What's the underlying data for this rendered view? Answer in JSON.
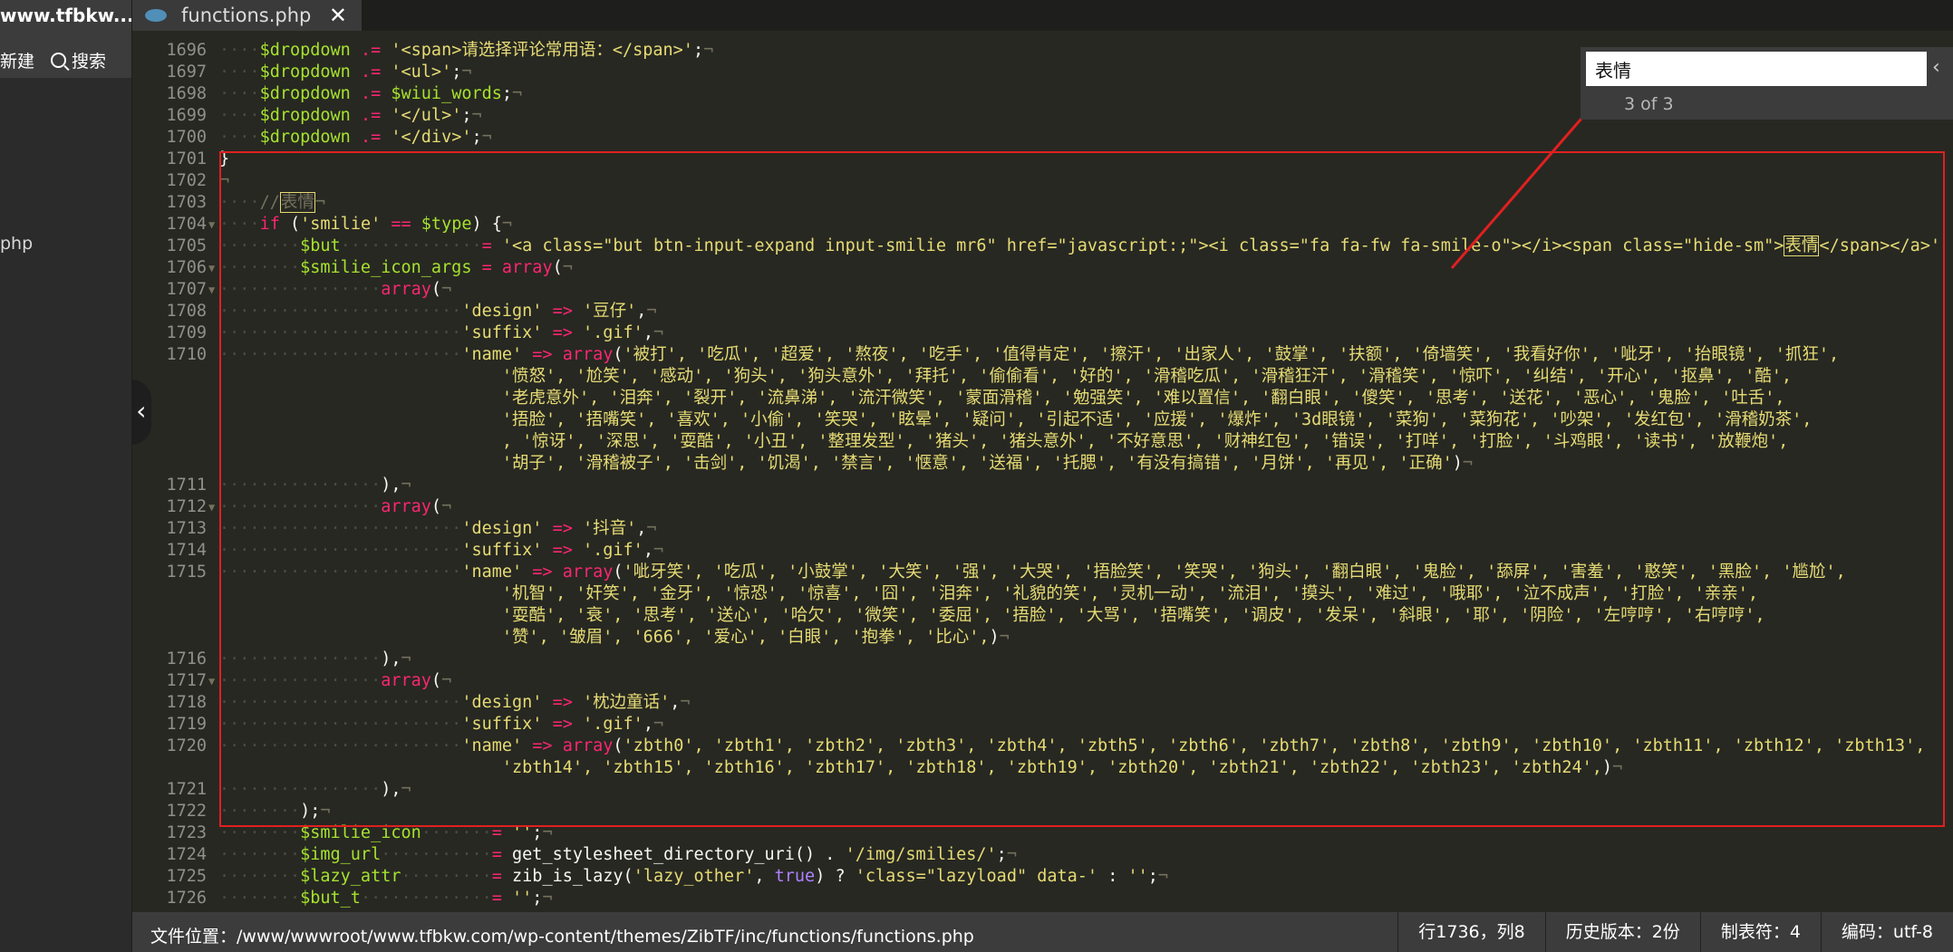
{
  "sidebar": {
    "site": "www.tfbkw....",
    "new_label": "新建",
    "search_label": "搜索",
    "file_item": "php"
  },
  "tab": {
    "name": "functions.php",
    "close": "✕"
  },
  "find": {
    "query": "表情",
    "count": "3 of 3"
  },
  "status": {
    "path_label": "文件位置：",
    "path": "/www/wwwroot/www.tfbkw.com/wp-content/themes/ZibTF/inc/functions/functions.php",
    "cursor": "行1736，列8",
    "history": "历史版本：2份",
    "tab": "制表符：4",
    "encoding": "编码：utf-8"
  },
  "code_lines": [
    {
      "n": "1696",
      "fold": false,
      "tokens": [
        [
          "ws",
          "····"
        ],
        [
          "var",
          "$dropdown"
        ],
        [
          "pu",
          " "
        ],
        [
          "op",
          ".="
        ],
        [
          "pu",
          " "
        ],
        [
          "str",
          "'<span>请选择评论常用语：</span>'"
        ],
        [
          "pu",
          ";"
        ],
        [
          "cm",
          "¬"
        ]
      ]
    },
    {
      "n": "1697",
      "fold": false,
      "tokens": [
        [
          "ws",
          "····"
        ],
        [
          "var",
          "$dropdown"
        ],
        [
          "pu",
          " "
        ],
        [
          "op",
          ".="
        ],
        [
          "pu",
          " "
        ],
        [
          "str",
          "'<ul>'"
        ],
        [
          "pu",
          ";"
        ],
        [
          "cm",
          "¬"
        ]
      ]
    },
    {
      "n": "1698",
      "fold": false,
      "tokens": [
        [
          "ws",
          "····"
        ],
        [
          "var",
          "$dropdown"
        ],
        [
          "pu",
          " "
        ],
        [
          "op",
          ".="
        ],
        [
          "pu",
          " "
        ],
        [
          "var",
          "$wiui_words"
        ],
        [
          "pu",
          ";"
        ],
        [
          "cm",
          "¬"
        ]
      ]
    },
    {
      "n": "1699",
      "fold": false,
      "tokens": [
        [
          "ws",
          "····"
        ],
        [
          "var",
          "$dropdown"
        ],
        [
          "pu",
          " "
        ],
        [
          "op",
          ".="
        ],
        [
          "pu",
          " "
        ],
        [
          "str",
          "'</ul>'"
        ],
        [
          "pu",
          ";"
        ],
        [
          "cm",
          "¬"
        ]
      ]
    },
    {
      "n": "1700",
      "fold": false,
      "tokens": [
        [
          "ws",
          "····"
        ],
        [
          "var",
          "$dropdown"
        ],
        [
          "pu",
          " "
        ],
        [
          "op",
          ".="
        ],
        [
          "pu",
          " "
        ],
        [
          "str",
          "'</div>'"
        ],
        [
          "pu",
          ";"
        ],
        [
          "cm",
          "¬"
        ]
      ]
    },
    {
      "n": "1701",
      "fold": false,
      "tokens": [
        [
          "pu",
          "}"
        ]
      ]
    },
    {
      "n": "1702",
      "fold": false,
      "tokens": [
        [
          "cm",
          "¬"
        ]
      ]
    },
    {
      "n": "1703",
      "fold": false,
      "tokens": [
        [
          "ws",
          "····"
        ],
        [
          "cm",
          "//"
        ],
        [
          "hit",
          "表情"
        ],
        [
          "cm",
          "¬"
        ]
      ]
    },
    {
      "n": "1704",
      "fold": true,
      "tokens": [
        [
          "ws",
          "····"
        ],
        [
          "kw",
          "if"
        ],
        [
          "pu",
          " ("
        ],
        [
          "str",
          "'smilie'"
        ],
        [
          "pu",
          " "
        ],
        [
          "op",
          "=="
        ],
        [
          "pu",
          " "
        ],
        [
          "var",
          "$type"
        ],
        [
          "pu",
          ") {"
        ],
        [
          "cm",
          "¬"
        ]
      ]
    },
    {
      "n": "1705",
      "fold": false,
      "tokens": [
        [
          "ws",
          "········"
        ],
        [
          "var",
          "$but"
        ],
        [
          "ws",
          "··············"
        ],
        [
          "op",
          "="
        ],
        [
          "pu",
          " "
        ],
        [
          "str",
          "'<a class=\"but btn-input-expand input-smilie mr6\" href=\"javascript:;\"><i class=\"fa fa-fw fa-smile-o\"></i><span class=\"hide-sm\">"
        ],
        [
          "hit2",
          "表情"
        ],
        [
          "str",
          "</span></a>'"
        ]
      ]
    },
    {
      "n": "1706",
      "fold": true,
      "tokens": [
        [
          "ws",
          "········"
        ],
        [
          "var",
          "$smilie_icon_args"
        ],
        [
          "pu",
          " "
        ],
        [
          "op",
          "="
        ],
        [
          "pu",
          " "
        ],
        [
          "kw",
          "array"
        ],
        [
          "pu",
          "("
        ],
        [
          "cm",
          "¬"
        ]
      ]
    },
    {
      "n": "1707",
      "fold": true,
      "tokens": [
        [
          "ws",
          "················"
        ],
        [
          "kw",
          "array"
        ],
        [
          "pu",
          "("
        ],
        [
          "cm",
          "¬"
        ]
      ]
    },
    {
      "n": "1708",
      "fold": false,
      "tokens": [
        [
          "ws",
          "························"
        ],
        [
          "str",
          "'design'"
        ],
        [
          "pu",
          " "
        ],
        [
          "op",
          "=>"
        ],
        [
          "pu",
          " "
        ],
        [
          "str",
          "'豆仔'"
        ],
        [
          "pu",
          ","
        ],
        [
          "cm",
          "¬"
        ]
      ]
    },
    {
      "n": "1709",
      "fold": false,
      "tokens": [
        [
          "ws",
          "························"
        ],
        [
          "str",
          "'suffix'"
        ],
        [
          "pu",
          " "
        ],
        [
          "op",
          "=>"
        ],
        [
          "pu",
          " "
        ],
        [
          "str",
          "'.gif'"
        ],
        [
          "pu",
          ","
        ],
        [
          "cm",
          "¬"
        ]
      ]
    },
    {
      "n": "1710",
      "fold": false,
      "tokens": [
        [
          "ws",
          "························"
        ],
        [
          "str",
          "'name'"
        ],
        [
          "pu",
          " "
        ],
        [
          "op",
          "=>"
        ],
        [
          "pu",
          " "
        ],
        [
          "kw",
          "array"
        ],
        [
          "pu",
          "("
        ],
        [
          "str",
          "'被打', '吃瓜', '超爱', '熬夜', '吃手', '值得肯定', '擦汗', '出家人', '鼓掌', '扶额', '倚墙笑', '我看好你', '呲牙', '抬眼镜', '抓狂',"
        ]
      ]
    },
    {
      "n": "",
      "fold": false,
      "tokens": [
        [
          "ws",
          "                            "
        ],
        [
          "str",
          "'愤怒', '尬笑', '感动', '狗头', '狗头意外', '拜托', '偷偷看', '好的', '滑稽吃瓜', '滑稽狂汗', '滑稽笑', '惊吓', '纠结', '开心', '抠鼻', '酷',"
        ]
      ]
    },
    {
      "n": "",
      "fold": false,
      "tokens": [
        [
          "ws",
          "                            "
        ],
        [
          "str",
          "'老虎意外', '泪奔', '裂开', '流鼻涕', '流汗微笑', '蒙面滑稽', '勉强笑', '难以置信', '翻白眼', '傻笑', '思考', '送花', '恶心', '鬼脸', '吐舌',"
        ]
      ]
    },
    {
      "n": "",
      "fold": false,
      "tokens": [
        [
          "ws",
          "                            "
        ],
        [
          "str",
          "'捂脸', '捂嘴笑', '喜欢', '小偷', '笑哭', '眩晕', '疑问', '引起不适', '应援', '爆炸', '3d眼镜', '菜狗', '菜狗花', '吵架', '发红包', '滑稽奶茶',"
        ]
      ]
    },
    {
      "n": "",
      "fold": false,
      "tokens": [
        [
          "ws",
          "                            "
        ],
        [
          "str",
          ", '惊讶', '深思', '耍酷', '小丑', '整理发型', '猪头', '猪头意外', '不好意思', '财神红包', '错误', '打咩', '打脸', '斗鸡眼', '读书', '放鞭炮',"
        ]
      ]
    },
    {
      "n": "",
      "fold": false,
      "tokens": [
        [
          "ws",
          "                            "
        ],
        [
          "str",
          "'胡子', '滑稽被子', '击剑', '饥渴', '禁言', '惬意', '送福', '托腮', '有没有搞错', '月饼', '再见', '正确'"
        ],
        [
          "pu",
          ")"
        ],
        [
          "cm",
          "¬"
        ]
      ]
    },
    {
      "n": "1711",
      "fold": false,
      "tokens": [
        [
          "ws",
          "················"
        ],
        [
          "pu",
          "),"
        ],
        [
          "cm",
          "¬"
        ]
      ]
    },
    {
      "n": "1712",
      "fold": true,
      "tokens": [
        [
          "ws",
          "················"
        ],
        [
          "kw",
          "array"
        ],
        [
          "pu",
          "("
        ],
        [
          "cm",
          "¬"
        ]
      ]
    },
    {
      "n": "1713",
      "fold": false,
      "tokens": [
        [
          "ws",
          "························"
        ],
        [
          "str",
          "'design'"
        ],
        [
          "pu",
          " "
        ],
        [
          "op",
          "=>"
        ],
        [
          "pu",
          " "
        ],
        [
          "str",
          "'抖音'"
        ],
        [
          "pu",
          ","
        ],
        [
          "cm",
          "¬"
        ]
      ]
    },
    {
      "n": "1714",
      "fold": false,
      "tokens": [
        [
          "ws",
          "························"
        ],
        [
          "str",
          "'suffix'"
        ],
        [
          "pu",
          " "
        ],
        [
          "op",
          "=>"
        ],
        [
          "pu",
          " "
        ],
        [
          "str",
          "'.gif'"
        ],
        [
          "pu",
          ","
        ],
        [
          "cm",
          "¬"
        ]
      ]
    },
    {
      "n": "1715",
      "fold": false,
      "tokens": [
        [
          "ws",
          "························"
        ],
        [
          "str",
          "'name'"
        ],
        [
          "pu",
          " "
        ],
        [
          "op",
          "=>"
        ],
        [
          "pu",
          " "
        ],
        [
          "kw",
          "array"
        ],
        [
          "pu",
          "("
        ],
        [
          "str",
          "'呲牙笑', '吃瓜', '小鼓掌', '大笑', '强', '大哭', '捂脸笑', '笑哭', '狗头', '翻白眼', '鬼脸', '舔屏', '害羞', '憨笑', '黑脸', '尴尬',"
        ]
      ]
    },
    {
      "n": "",
      "fold": false,
      "tokens": [
        [
          "ws",
          "                            "
        ],
        [
          "str",
          "'机智', '奸笑', '金牙', '惊恐', '惊喜', '囧', '泪奔', '礼貌的笑', '灵机一动', '流泪', '摸头', '难过', '哦耶', '泣不成声', '打脸', '亲亲',"
        ]
      ]
    },
    {
      "n": "",
      "fold": false,
      "tokens": [
        [
          "ws",
          "                            "
        ],
        [
          "str",
          "'耍酷', '衰', '思考', '送心', '哈欠', '微笑', '委屈', '捂脸', '大骂', '捂嘴笑', '调皮', '发呆', '斜眼', '耶', '阴险', '左哼哼', '右哼哼',"
        ]
      ]
    },
    {
      "n": "",
      "fold": false,
      "tokens": [
        [
          "ws",
          "                            "
        ],
        [
          "str",
          "'赞', '皱眉', '666', '爱心', '白眼', '抱拳', '比心',"
        ],
        [
          "pu",
          ")"
        ],
        [
          "cm",
          "¬"
        ]
      ]
    },
    {
      "n": "1716",
      "fold": false,
      "tokens": [
        [
          "ws",
          "················"
        ],
        [
          "pu",
          "),"
        ],
        [
          "cm",
          "¬"
        ]
      ]
    },
    {
      "n": "1717",
      "fold": true,
      "tokens": [
        [
          "ws",
          "················"
        ],
        [
          "kw",
          "array"
        ],
        [
          "pu",
          "("
        ],
        [
          "cm",
          "¬"
        ]
      ]
    },
    {
      "n": "1718",
      "fold": false,
      "tokens": [
        [
          "ws",
          "························"
        ],
        [
          "str",
          "'design'"
        ],
        [
          "pu",
          " "
        ],
        [
          "op",
          "=>"
        ],
        [
          "pu",
          " "
        ],
        [
          "str",
          "'枕边童话'"
        ],
        [
          "pu",
          ","
        ],
        [
          "cm",
          "¬"
        ]
      ]
    },
    {
      "n": "1719",
      "fold": false,
      "tokens": [
        [
          "ws",
          "························"
        ],
        [
          "str",
          "'suffix'"
        ],
        [
          "pu",
          " "
        ],
        [
          "op",
          "=>"
        ],
        [
          "pu",
          " "
        ],
        [
          "str",
          "'.gif'"
        ],
        [
          "pu",
          ","
        ],
        [
          "cm",
          "¬"
        ]
      ]
    },
    {
      "n": "1720",
      "fold": false,
      "tokens": [
        [
          "ws",
          "························"
        ],
        [
          "str",
          "'name'"
        ],
        [
          "pu",
          " "
        ],
        [
          "op",
          "=>"
        ],
        [
          "pu",
          " "
        ],
        [
          "kw",
          "array"
        ],
        [
          "pu",
          "("
        ],
        [
          "str",
          "'zbth0', 'zbth1', 'zbth2', 'zbth3', 'zbth4', 'zbth5', 'zbth6', 'zbth7', 'zbth8', 'zbth9', 'zbth10', 'zbth11', 'zbth12', 'zbth13',"
        ]
      ]
    },
    {
      "n": "",
      "fold": false,
      "tokens": [
        [
          "ws",
          "                            "
        ],
        [
          "str",
          "'zbth14', 'zbth15', 'zbth16', 'zbth17', 'zbth18', 'zbth19', 'zbth20', 'zbth21', 'zbth22', 'zbth23', 'zbth24',"
        ],
        [
          "pu",
          ")"
        ],
        [
          "cm",
          "¬"
        ]
      ]
    },
    {
      "n": "1721",
      "fold": false,
      "tokens": [
        [
          "ws",
          "················"
        ],
        [
          "pu",
          "),"
        ],
        [
          "cm",
          "¬"
        ]
      ]
    },
    {
      "n": "1722",
      "fold": false,
      "tokens": [
        [
          "ws",
          "········"
        ],
        [
          "pu",
          ");"
        ],
        [
          "cm",
          "¬"
        ]
      ]
    },
    {
      "n": "1723",
      "fold": false,
      "tokens": [
        [
          "ws",
          "········"
        ],
        [
          "var",
          "$smilie_icon"
        ],
        [
          "ws",
          "·······"
        ],
        [
          "op",
          "="
        ],
        [
          "pu",
          " "
        ],
        [
          "str",
          "''"
        ],
        [
          "pu",
          ";"
        ],
        [
          "cm",
          "¬"
        ]
      ]
    },
    {
      "n": "1724",
      "fold": false,
      "tokens": [
        [
          "ws",
          "········"
        ],
        [
          "var",
          "$img_url"
        ],
        [
          "ws",
          "···········"
        ],
        [
          "op",
          "="
        ],
        [
          "pu",
          " get_stylesheet_directory_uri() . "
        ],
        [
          "str",
          "'/img/smilies/'"
        ],
        [
          "pu",
          ";"
        ],
        [
          "cm",
          "¬"
        ]
      ]
    },
    {
      "n": "1725",
      "fold": false,
      "tokens": [
        [
          "ws",
          "········"
        ],
        [
          "var",
          "$lazy_attr"
        ],
        [
          "ws",
          "·········"
        ],
        [
          "op",
          "="
        ],
        [
          "pu",
          " zib_is_lazy("
        ],
        [
          "str",
          "'lazy_other'"
        ],
        [
          "pu",
          ", "
        ],
        [
          "bool",
          "true"
        ],
        [
          "pu",
          ") ? "
        ],
        [
          "str",
          "'class=\"lazyload\" data-'"
        ],
        [
          "pu",
          " : "
        ],
        [
          "str",
          "''"
        ],
        [
          "pu",
          ";"
        ],
        [
          "cm",
          "¬"
        ]
      ]
    },
    {
      "n": "1726",
      "fold": false,
      "tokens": [
        [
          "ws",
          "········"
        ],
        [
          "var",
          "$but_t"
        ],
        [
          "ws",
          "·············"
        ],
        [
          "op",
          "="
        ],
        [
          "pu",
          " "
        ],
        [
          "str",
          "''"
        ],
        [
          "pu",
          ";"
        ],
        [
          "cm",
          "¬"
        ]
      ]
    }
  ]
}
